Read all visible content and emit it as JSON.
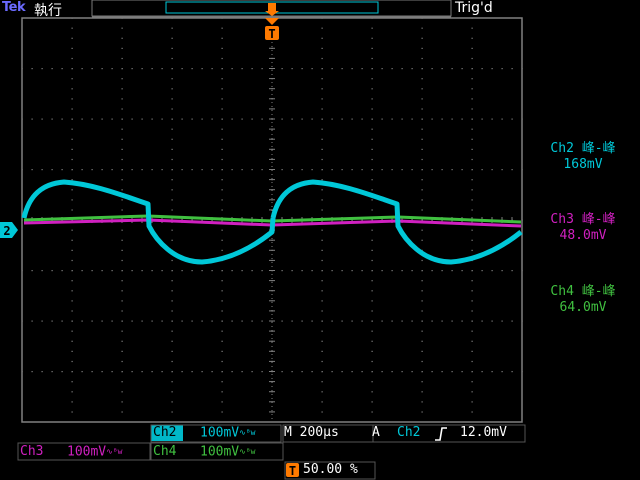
{
  "top_bar": {
    "brand": "Tek",
    "run_state": "執行",
    "trigger_status": "Trig'd"
  },
  "trigger_marker": {
    "label": "T"
  },
  "channel_marker": {
    "label": "2"
  },
  "measurements": [
    {
      "label": "Ch2 峰-峰",
      "value": "168mV",
      "color": "#00c8d8"
    },
    {
      "label": "Ch3 峰-峰",
      "value": "48.0mV",
      "color": "#d020c0"
    },
    {
      "label": "Ch4 峰-峰",
      "value": "64.0mV",
      "color": "#40c040"
    }
  ],
  "bottom": {
    "ch2": {
      "name": "Ch2",
      "scale": "100mV",
      "color": "#00c8d8"
    },
    "ch3": {
      "name": "Ch3",
      "scale": "100mV",
      "color": "#d020c0"
    },
    "ch4": {
      "name": "Ch4",
      "scale": "100mV",
      "color": "#40c040"
    },
    "timebase": {
      "prefix": "M",
      "value": "200µs"
    },
    "trigger": {
      "mode": "A",
      "source": "Ch2",
      "slope": "rising-edge",
      "level": "12.0mV"
    },
    "position": {
      "value": "50.00 %"
    }
  },
  "colors": {
    "grid": "#808080",
    "ch2": "#00c8d8",
    "ch3": "#d020c0",
    "ch4": "#40c040",
    "trigger": "#ff7a00"
  }
}
